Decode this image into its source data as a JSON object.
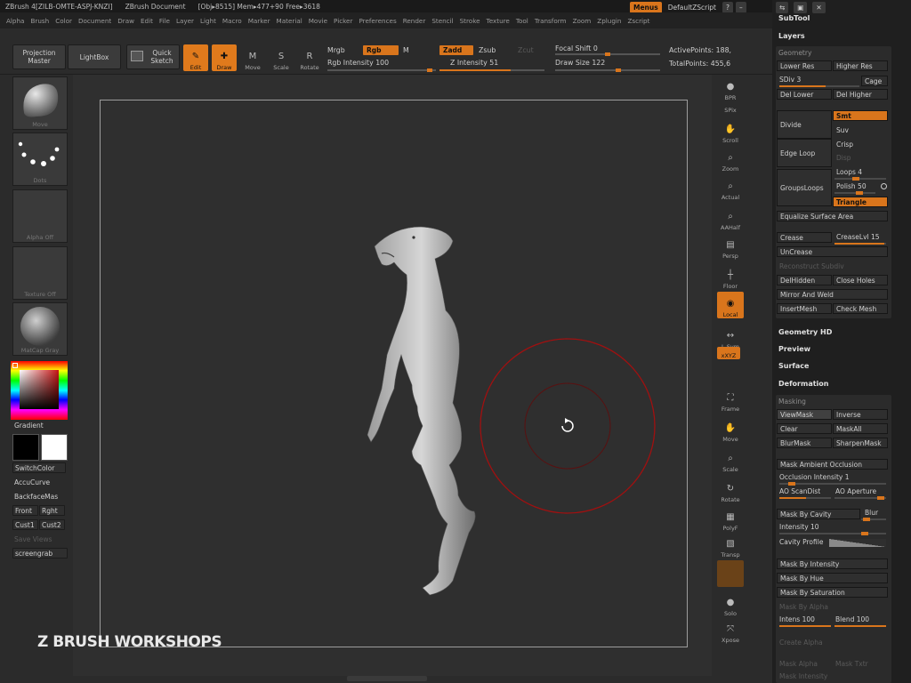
{
  "titlebar": {
    "items": [
      "ZBrush 4[ZILB-OMTE-ASPJ-KNZI]",
      "ZBrush Document",
      "[Obj▸8515] Mem▸477+90 Free▸3618"
    ]
  },
  "window_controls": {
    "menus": "Menus",
    "script": "DefaultZScript"
  },
  "menubar": [
    "Alpha",
    "Brush",
    "Color",
    "Document",
    "Draw",
    "Edit",
    "File",
    "Layer",
    "Light",
    "Macro",
    "Marker",
    "Material",
    "Movie",
    "Picker",
    "Preferences",
    "Render",
    "Stencil",
    "Stroke",
    "Texture",
    "Tool",
    "Transform",
    "Zoom",
    "Zplugin",
    "Zscript"
  ],
  "shelf": {
    "projection_master": "Projection Master",
    "lightbox": "LightBox",
    "quick_sketch": "Quick Sketch",
    "tools": [
      {
        "label": "Edit",
        "active": true
      },
      {
        "label": "Draw",
        "active": true
      },
      {
        "label": "Move",
        "active": false
      },
      {
        "label": "Scale",
        "active": false
      },
      {
        "label": "Rotate",
        "active": false
      }
    ],
    "mrgb": "Mrgb",
    "rgb": "Rgb",
    "m": "M",
    "rgb_intensity": "Rgb Intensity 100",
    "zadd": "Zadd",
    "zsub": "Zsub",
    "zcut": "Zcut",
    "z_intensity": "Z Intensity 51",
    "focal_shift": "Focal Shift 0",
    "draw_size": "Draw Size 122",
    "active_points": "ActivePoints: 188,",
    "total_points": "TotalPoints: 455,6"
  },
  "left_tray": {
    "brush_caption": "Move",
    "stroke_caption": "Dots",
    "alpha_caption": "Alpha Off",
    "texture_caption": "Texture Off",
    "material_caption": "MatCap Gray",
    "gradient": "Gradient",
    "switchcolor": "SwitchColor",
    "accucurve": "AccuCurve",
    "backfacemask": "BackfaceMas",
    "front": "Front",
    "right": "Rght",
    "cust1": "Cust1",
    "cust2": "Cust2",
    "save_view": "Save Views",
    "screengrab": "screengrab"
  },
  "watermark": "Z BRUSH WORKSHOPS",
  "right_tools": [
    {
      "label": "BPR"
    },
    {
      "label": "SPix"
    },
    {
      "label": "Scroll"
    },
    {
      "label": "Zoom"
    },
    {
      "label": "Actual"
    },
    {
      "label": "AAHalf"
    },
    {
      "label": "Persp"
    },
    {
      "label": "Floor"
    },
    {
      "label": "Local"
    },
    {
      "label": "L.Sym"
    },
    {
      "label": "xXYZ"
    },
    {
      "label": "Frame"
    },
    {
      "label": "Move"
    },
    {
      "label": "Scale"
    },
    {
      "label": "Rotate"
    },
    {
      "label": "PolyF"
    },
    {
      "label": "Transp"
    },
    {
      "label": "Solo"
    },
    {
      "label": "Xpose"
    }
  ],
  "panel": {
    "subtool": "SubTool",
    "layers": "Layers",
    "geometry": "Geometry",
    "lower_res": "Lower Res",
    "higher_res": "Higher Res",
    "sdiv": "SDiv 3",
    "cage": "Cage",
    "del_lower": "Del Lower",
    "del_higher": "Del Higher",
    "divide": "Divide",
    "smt": "Smt",
    "suv": "Suv",
    "edge_loop": "Edge Loop",
    "crisp": "Crisp",
    "disp": "Disp",
    "groupsloops": "GroupsLoops",
    "loops": "Loops 4",
    "polish": "Polish 50",
    "triangle": "Triangle",
    "equalize": "Equalize Surface Area",
    "crease": "Crease",
    "creaselvl": "CreaseLvl 15",
    "uncrease": "UnCrease",
    "reconstruct": "Reconstruct Subdiv",
    "delhidden": "DelHidden",
    "close_holes": "Close Holes",
    "mirror_weld": "Mirror And Weld",
    "insertmesh": "InsertMesh",
    "check_mesh": "Check Mesh",
    "geometry_hd": "Geometry HD",
    "preview": "Preview",
    "surface": "Surface",
    "deformation": "Deformation",
    "masking": "Masking",
    "viewmask": "ViewMask",
    "inverse": "Inverse",
    "clear": "Clear",
    "maskall": "MaskAll",
    "blurmask": "BlurMask",
    "sharpenmask": "SharpenMask",
    "mask_ao": "Mask Ambient Occlusion",
    "occlusion_intensity": "Occlusion Intensity 1",
    "ao_scandist": "AO ScanDist",
    "ao_aperture": "AO Aperture",
    "mask_cavity": "Mask By Cavity",
    "blur": "Blur",
    "intensity": "Intensity 10",
    "cavity_profile": "Cavity Profile",
    "mask_intensity": "Mask By Intensity",
    "mask_hue": "Mask By Hue",
    "mask_saturation": "Mask By Saturation",
    "mask_alpha": "Mask By Alpha",
    "intens": "Intens 100",
    "blend": "Blend 100",
    "create_alpha": "Create Alpha",
    "mask_alpha2": "Mask Alpha",
    "mask_txtr": "Mask Txtr",
    "mask_intensity2": "Mask Intensity"
  },
  "colors": {
    "accent": "#d9751c",
    "brush_ring": "#a01010"
  }
}
